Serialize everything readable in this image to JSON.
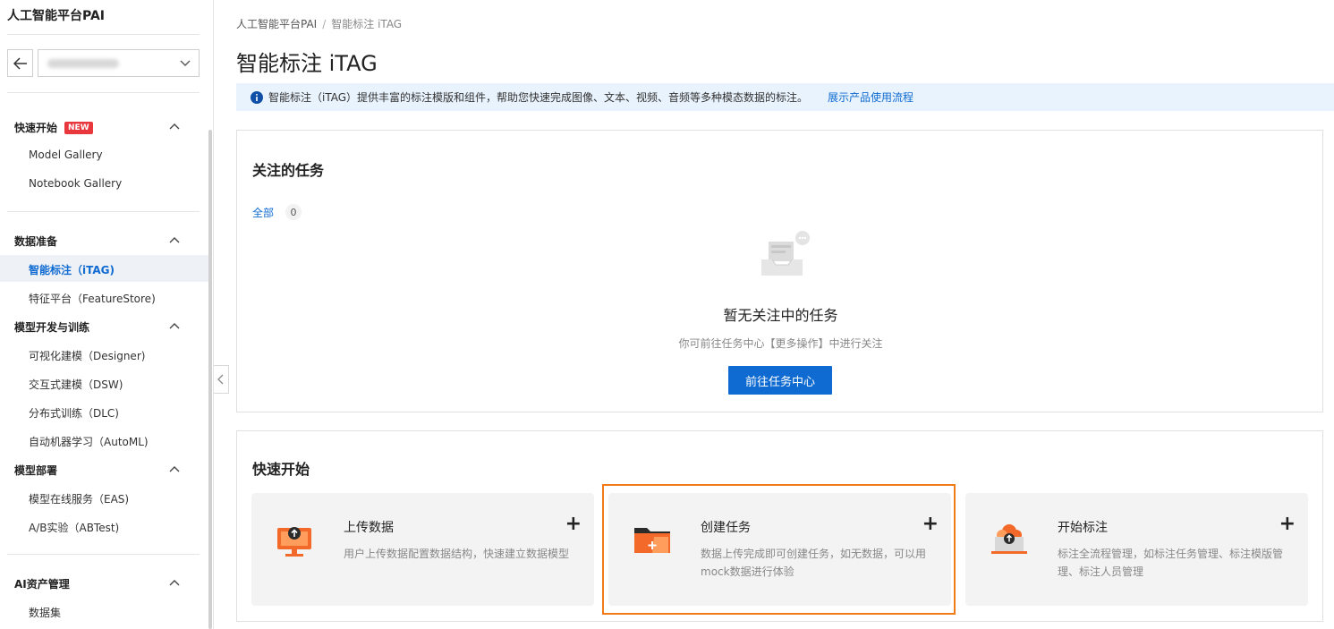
{
  "sidebar": {
    "app_title": "人工智能平台PAI",
    "new_badge": "NEW",
    "groups": [
      {
        "label": "快速开始",
        "items": [
          "Model Gallery",
          "Notebook Gallery"
        ]
      },
      {
        "label": "数据准备",
        "items": [
          "智能标注（iTAG)",
          "特征平台（FeatureStore)"
        ]
      },
      {
        "label": "模型开发与训练",
        "items": [
          "可视化建模（Designer)",
          "交互式建模（DSW)",
          "分布式训练（DLC)",
          "自动机器学习（AutoML)"
        ]
      },
      {
        "label": "模型部署",
        "items": [
          "模型在线服务（EAS)",
          "A/B实验（ABTest)"
        ]
      },
      {
        "label": "AI资产管理",
        "items": [
          "数据集"
        ]
      }
    ],
    "active_item": "智能标注（iTAG)"
  },
  "breadcrumb": {
    "root": "人工智能平台PAI",
    "separator": "/",
    "current": "智能标注 iTAG"
  },
  "page_title": "智能标注 iTAG",
  "info_bar": {
    "text": "智能标注（iTAG）提供丰富的标注模版和组件，帮助您快速完成图像、文本、视频、音频等多种模态数据的标注。",
    "link": "展示产品使用流程"
  },
  "followed_tasks": {
    "title": "关注的任务",
    "filter_label": "全部",
    "filter_count": "0",
    "empty_title": "暂无关注中的任务",
    "empty_sub": "你可前往任务中心【更多操作】中进行关注",
    "button": "前往任务中心"
  },
  "quick_start": {
    "title": "快速开始",
    "cards": [
      {
        "name": "上传数据",
        "desc": "用户上传数据配置数据结构，快速建立数据模型",
        "icon": "upload-monitor-icon",
        "plus": "+"
      },
      {
        "name": "创建任务",
        "desc": "数据上传完成即可创建任务，如无数据，可以用mock数据进行体验",
        "icon": "folder-plus-icon",
        "plus": "+"
      },
      {
        "name": "开始标注",
        "desc": "标注全流程管理，如标注任务管理、标注模版管理、标注人员管理",
        "icon": "cloud-laptop-icon",
        "plus": "+"
      }
    ]
  },
  "colors": {
    "primary": "#0f6bd1",
    "accent_orange": "#f07c17",
    "badge_red": "#e8383d",
    "info_bg": "#e9f3fd"
  }
}
